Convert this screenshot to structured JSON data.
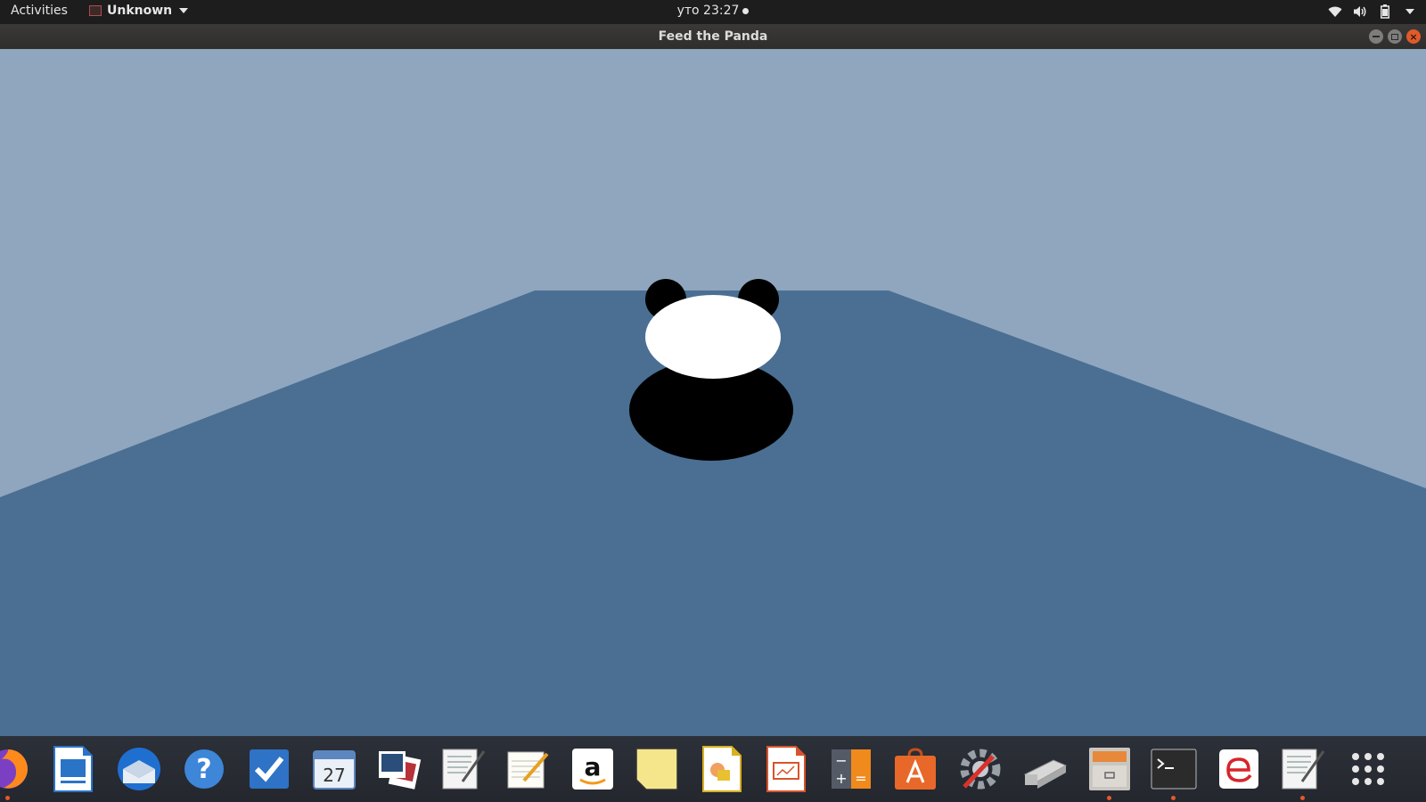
{
  "topbar": {
    "activities_label": "Activities",
    "app_name": "Unknown",
    "clock": "уто 23:27",
    "status_icons": [
      "wifi-icon",
      "volume-icon",
      "battery-icon",
      "system-menu-chevron-icon"
    ]
  },
  "window": {
    "title": "Feed the Panda",
    "controls": [
      "minimize",
      "maximize",
      "close"
    ]
  },
  "game": {
    "colors": {
      "sky": "#8fa6be",
      "floor": "#4a6f93",
      "panda_white": "#ffffff",
      "panda_black": "#000000"
    }
  },
  "dock": {
    "apps": [
      {
        "name": "firefox",
        "icon": "firefox-icon",
        "running": true
      },
      {
        "name": "libreoffice-writer",
        "icon": "writer-icon",
        "running": false
      },
      {
        "name": "thunderbird",
        "icon": "thunderbird-icon",
        "running": false
      },
      {
        "name": "help",
        "icon": "help-icon",
        "running": false
      },
      {
        "name": "tasks",
        "icon": "tasks-icon",
        "running": false
      },
      {
        "name": "calendar",
        "icon": "calendar-icon",
        "running": false,
        "label": "27"
      },
      {
        "name": "image-viewer",
        "icon": "photos-icon",
        "running": false
      },
      {
        "name": "text-editor-a",
        "icon": "document-editor-icon",
        "running": false
      },
      {
        "name": "notes",
        "icon": "notepad-icon",
        "running": false
      },
      {
        "name": "amazon",
        "icon": "amazon-icon",
        "running": false,
        "label": "a"
      },
      {
        "name": "sticky-notes",
        "icon": "sticky-notes-icon",
        "running": false
      },
      {
        "name": "libreoffice-draw",
        "icon": "draw-icon",
        "running": false
      },
      {
        "name": "libreoffice-impress",
        "icon": "impress-icon",
        "running": false
      },
      {
        "name": "calculator",
        "icon": "calculator-icon",
        "running": false
      },
      {
        "name": "software-center",
        "icon": "software-center-icon",
        "running": false
      },
      {
        "name": "settings",
        "icon": "settings-tools-icon",
        "running": false
      },
      {
        "name": "scanner",
        "icon": "scanner-icon",
        "running": false
      },
      {
        "name": "file-cabinet",
        "icon": "file-cabinet-icon",
        "running": true
      },
      {
        "name": "terminal",
        "icon": "terminal-icon",
        "running": true
      },
      {
        "name": "remote-app",
        "icon": "red-e-icon",
        "running": false
      },
      {
        "name": "text-editor-b",
        "icon": "document-editor-icon",
        "running": true
      },
      {
        "name": "show-applications",
        "icon": "app-grid-icon",
        "running": false
      }
    ]
  }
}
